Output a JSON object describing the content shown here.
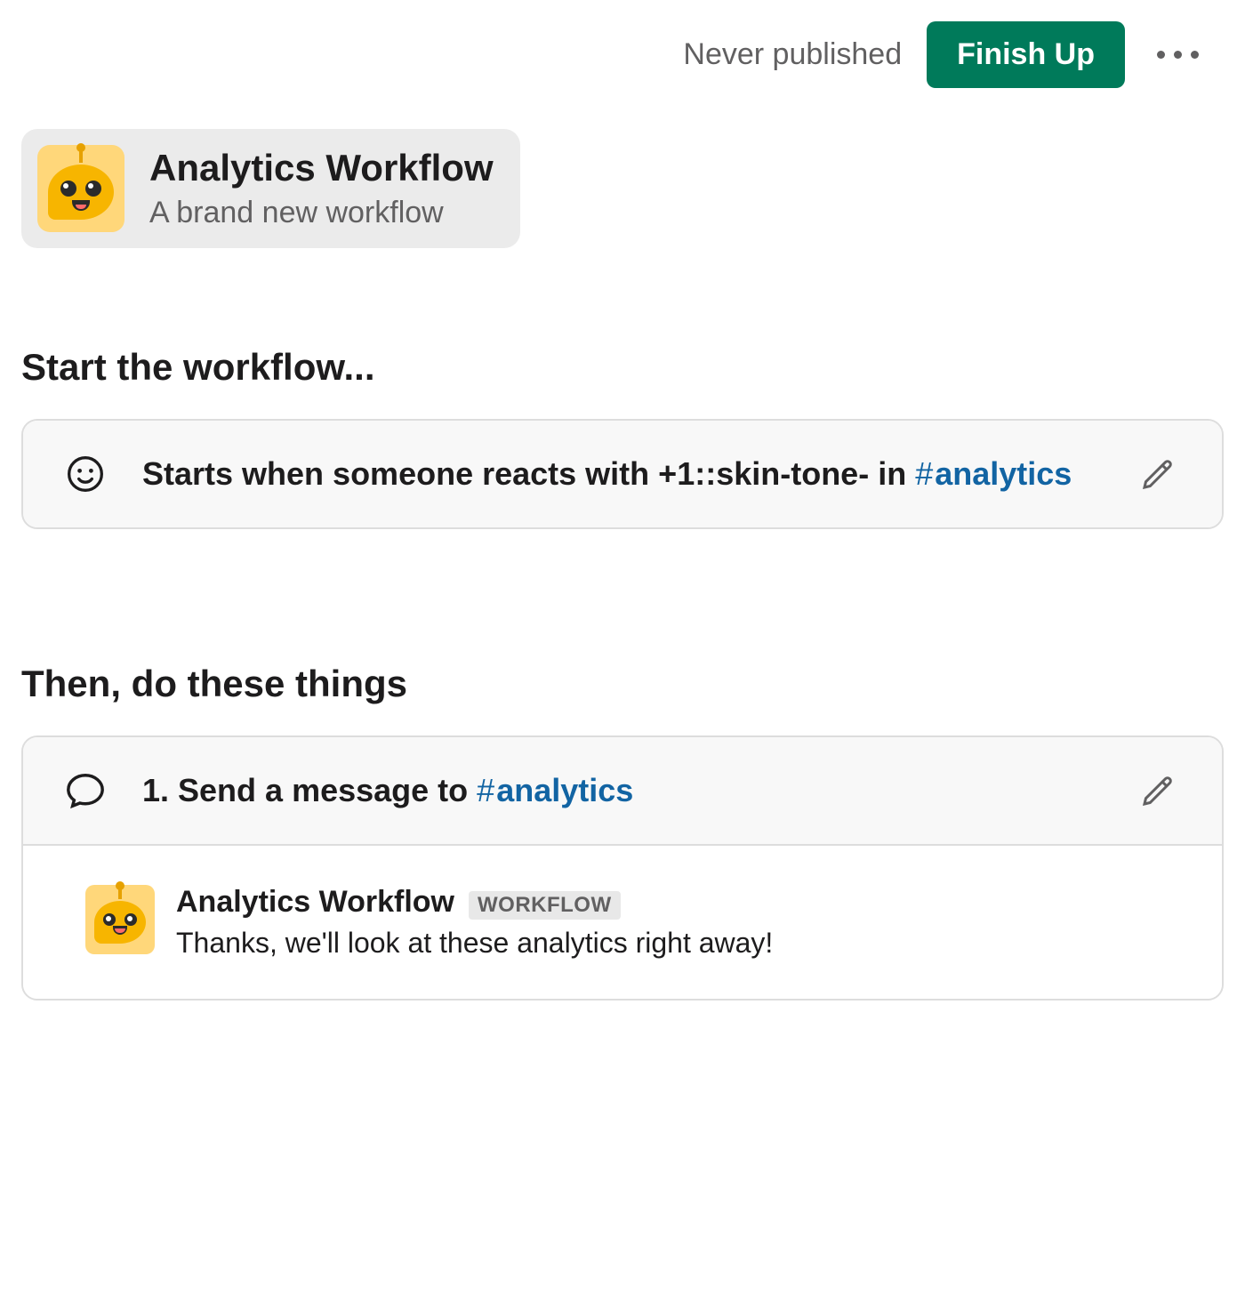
{
  "topbar": {
    "status": "Never published",
    "finish_label": "Finish Up"
  },
  "workflow": {
    "title": "Analytics Workflow",
    "subtitle": "A brand new workflow"
  },
  "sections": {
    "start_heading": "Start the workflow...",
    "then_heading": "Then, do these things"
  },
  "trigger": {
    "text_prefix": "Starts when someone reacts with +1::skin-tone- in ",
    "channel": "analytics"
  },
  "step1": {
    "title_prefix": "1. Send a message to ",
    "channel": "analytics",
    "author": "Analytics Workflow",
    "badge": "WORKFLOW",
    "message": "Thanks, we'll look at these analytics right away!"
  },
  "colors": {
    "accent_green": "#007a5a",
    "link_blue": "#1264a3"
  }
}
